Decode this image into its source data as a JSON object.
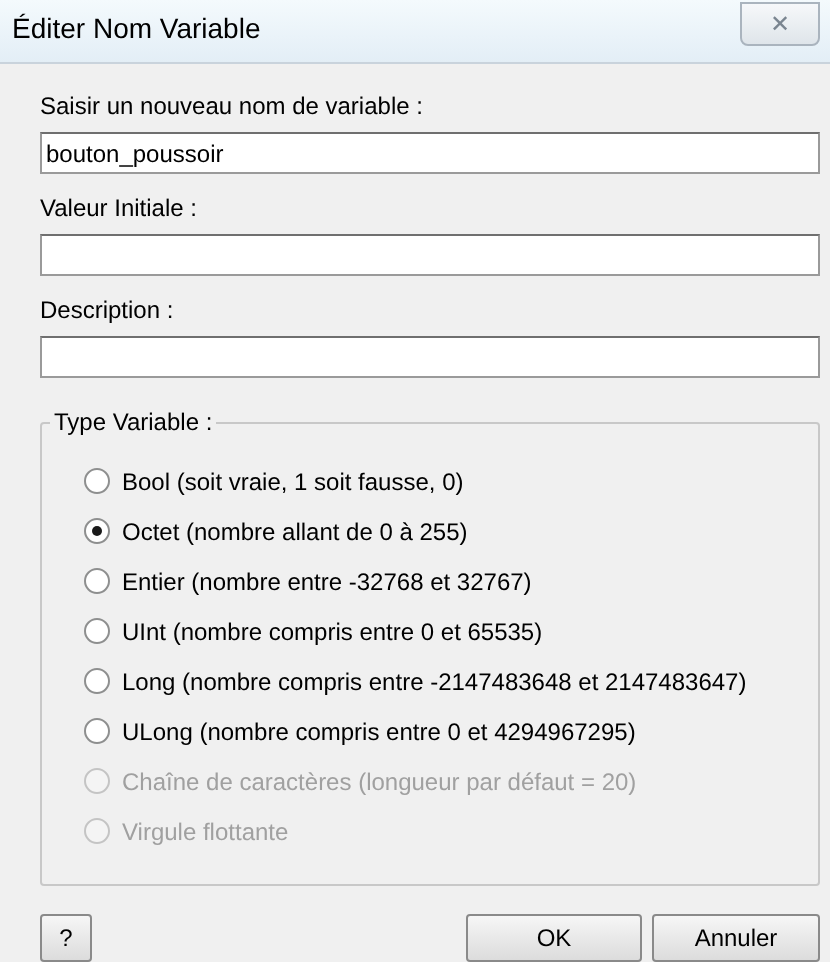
{
  "window": {
    "title": "Éditer Nom Variable",
    "close": "✕"
  },
  "fields": [
    {
      "label": "Saisir un nouveau nom de variable :",
      "value": "bouton_poussoir"
    },
    {
      "label": "Valeur Initiale :"
    },
    {
      "label": "Description :"
    }
  ],
  "group": {
    "title": "Type Variable :",
    "options": [
      {
        "label": "Bool (soit vraie, 1 soit fausse, 0)",
        "selected": false,
        "disabled": false
      },
      {
        "label": "Octet (nombre allant de 0 à 255)",
        "selected": true,
        "disabled": false
      },
      {
        "label": "Entier (nombre entre -32768 et 32767)",
        "selected": false,
        "disabled": false
      },
      {
        "label": "UInt (nombre compris entre 0 et 65535)",
        "selected": false,
        "disabled": false
      },
      {
        "label": "Long (nombre compris entre -2147483648 et 2147483647)",
        "selected": false,
        "disabled": false
      },
      {
        "label": "ULong (nombre compris entre 0 et 4294967295)",
        "selected": false,
        "disabled": false
      },
      {
        "label": "Chaîne de caractères (longueur par défaut = 20)",
        "selected": false,
        "disabled": true
      },
      {
        "label": "Virgule flottante",
        "selected": false,
        "disabled": true
      }
    ]
  },
  "buttons": {
    "help": "?",
    "ok": "OK",
    "cancel": "Annuler"
  }
}
